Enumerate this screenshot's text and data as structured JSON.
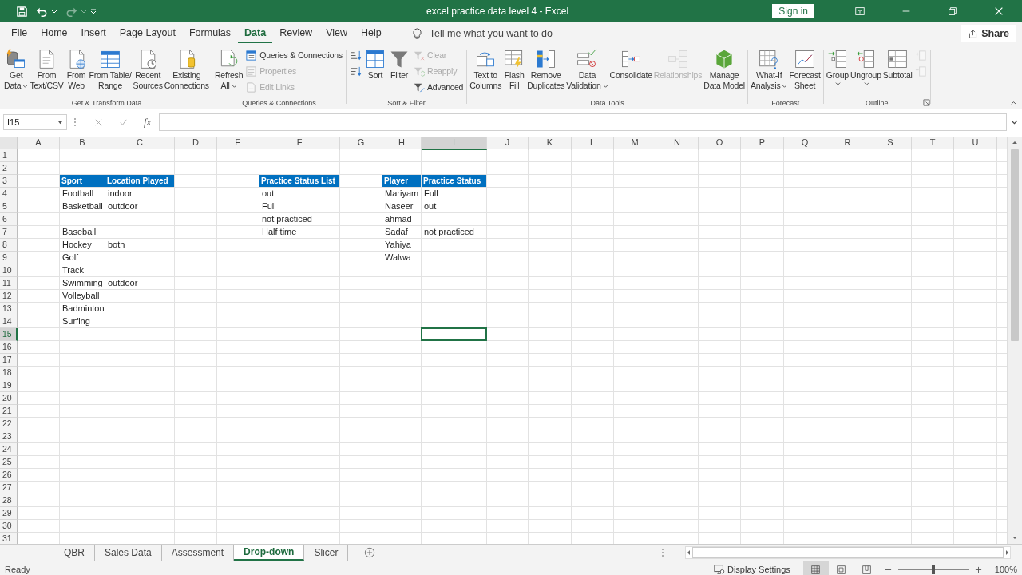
{
  "window": {
    "title": "excel practice data level 4  -  Excel",
    "sign_in": "Sign in"
  },
  "tabs": [
    {
      "label": "File",
      "selected": false
    },
    {
      "label": "Home",
      "selected": false
    },
    {
      "label": "Insert",
      "selected": false
    },
    {
      "label": "Page Layout",
      "selected": false
    },
    {
      "label": "Formulas",
      "selected": false
    },
    {
      "label": "Data",
      "selected": true
    },
    {
      "label": "Review",
      "selected": false
    },
    {
      "label": "View",
      "selected": false
    },
    {
      "label": "Help",
      "selected": false
    }
  ],
  "tell_me": {
    "placeholder": "Tell me what you want to do"
  },
  "share": "Share",
  "ribbon": [
    {
      "label": "Get & Transform Data",
      "launcher": false,
      "items": [
        {
          "kind": "large",
          "lines": [
            "Get",
            "Data"
          ],
          "dropdown": true,
          "disabled": false
        },
        {
          "kind": "large",
          "lines": [
            "From",
            "Text/CSV"
          ],
          "dropdown": false,
          "disabled": false
        },
        {
          "kind": "large",
          "lines": [
            "From",
            "Web"
          ],
          "dropdown": false,
          "disabled": false
        },
        {
          "kind": "large",
          "lines": [
            "From Table/",
            "Range"
          ],
          "dropdown": false,
          "disabled": false
        },
        {
          "kind": "large",
          "lines": [
            "Recent",
            "Sources"
          ],
          "dropdown": false,
          "disabled": false
        },
        {
          "kind": "large",
          "lines": [
            "Existing",
            "Connections"
          ],
          "dropdown": false,
          "disabled": false
        }
      ]
    },
    {
      "label": "Queries & Connections",
      "launcher": false,
      "items": [
        {
          "kind": "large",
          "lines": [
            "Refresh",
            "All"
          ],
          "dropdown": true,
          "disabled": false
        },
        {
          "kind": "stack",
          "buttons": [
            {
              "label": "Queries & Connections",
              "disabled": false
            },
            {
              "label": "Properties",
              "disabled": true
            },
            {
              "label": "Edit Links",
              "disabled": true
            }
          ]
        }
      ]
    },
    {
      "label": "Sort & Filter",
      "launcher": false,
      "items": [
        {
          "kind": "stack",
          "buttons": [
            {
              "disabled": false
            },
            {
              "disabled": false
            }
          ]
        },
        {
          "kind": "large",
          "lines": [
            "Sort"
          ],
          "dropdown": false,
          "disabled": false
        },
        {
          "kind": "large",
          "lines": [
            "Filter"
          ],
          "dropdown": false,
          "disabled": false
        },
        {
          "kind": "stack",
          "buttons": [
            {
              "label": "Clear",
              "disabled": true
            },
            {
              "label": "Reapply",
              "disabled": true
            },
            {
              "label": "Advanced",
              "disabled": false
            }
          ]
        }
      ]
    },
    {
      "label": "Data Tools",
      "launcher": false,
      "items": [
        {
          "kind": "large",
          "lines": [
            "Text to",
            "Columns"
          ],
          "dropdown": false,
          "disabled": false
        },
        {
          "kind": "large",
          "lines": [
            "Flash",
            "Fill"
          ],
          "dropdown": false,
          "disabled": false
        },
        {
          "kind": "large",
          "lines": [
            "Remove",
            "Duplicates"
          ],
          "dropdown": false,
          "disabled": false
        },
        {
          "kind": "large",
          "lines": [
            "Data",
            "Validation"
          ],
          "dropdown": true,
          "disabled": false
        },
        {
          "kind": "large",
          "lines": [
            "Consolidate"
          ],
          "dropdown": false,
          "disabled": false
        },
        {
          "kind": "large",
          "lines": [
            "Relationships"
          ],
          "dropdown": false,
          "disabled": true
        },
        {
          "kind": "large",
          "lines": [
            "Manage",
            "Data Model"
          ],
          "dropdown": false,
          "disabled": false
        }
      ]
    },
    {
      "label": "Forecast",
      "launcher": false,
      "items": [
        {
          "kind": "large",
          "lines": [
            "What-If",
            "Analysis"
          ],
          "dropdown": true,
          "disabled": false
        },
        {
          "kind": "large",
          "lines": [
            "Forecast",
            "Sheet"
          ],
          "dropdown": false,
          "disabled": false
        }
      ]
    },
    {
      "label": "Outline",
      "launcher": true,
      "items": [
        {
          "kind": "large",
          "lines": [
            "Group"
          ],
          "dropdown": true,
          "disabled": false
        },
        {
          "kind": "large",
          "lines": [
            "Ungroup"
          ],
          "dropdown": true,
          "disabled": false
        },
        {
          "kind": "large",
          "lines": [
            "Subtotal"
          ],
          "dropdown": false,
          "disabled": false
        },
        {
          "kind": "stack",
          "buttons": [
            {
              "disabled": true
            },
            {
              "disabled": true
            }
          ]
        }
      ]
    }
  ],
  "formula_bar": {
    "name_box": "I15",
    "function_label": "fx"
  },
  "columns": [
    {
      "label": "A",
      "selected": false
    },
    {
      "label": "B",
      "selected": false
    },
    {
      "label": "C",
      "selected": false
    },
    {
      "label": "D",
      "selected": false
    },
    {
      "label": "E",
      "selected": false
    },
    {
      "label": "F",
      "selected": false
    },
    {
      "label": "G",
      "selected": false
    },
    {
      "label": "H",
      "selected": false
    },
    {
      "label": "I",
      "selected": true
    },
    {
      "label": "J",
      "selected": false
    },
    {
      "label": "K",
      "selected": false
    },
    {
      "label": "L",
      "selected": false
    },
    {
      "label": "M",
      "selected": false
    },
    {
      "label": "N",
      "selected": false
    },
    {
      "label": "O",
      "selected": false
    },
    {
      "label": "P",
      "selected": false
    },
    {
      "label": "Q",
      "selected": false
    },
    {
      "label": "R",
      "selected": false
    },
    {
      "label": "S",
      "selected": false
    },
    {
      "label": "T",
      "selected": false
    },
    {
      "label": "U",
      "selected": false
    }
  ],
  "rows": [
    {
      "number": "1",
      "selected": false
    },
    {
      "number": "2",
      "selected": false
    },
    {
      "number": "3",
      "selected": false,
      "cells": [
        null,
        {
          "text": "Sport",
          "kind": "header"
        },
        {
          "text": "Location Played",
          "kind": "header"
        },
        null,
        null,
        {
          "text": "Practice Status List",
          "kind": "header"
        },
        null,
        {
          "text": "Player",
          "kind": "header"
        },
        {
          "text": "Practice Status",
          "kind": "header"
        }
      ]
    },
    {
      "number": "4",
      "selected": false,
      "cells": [
        null,
        {
          "text": "Football",
          "kind": "value"
        },
        {
          "text": "indoor",
          "kind": "value"
        },
        null,
        null,
        {
          "text": "out",
          "kind": "value"
        },
        null,
        {
          "text": "Mariyam",
          "kind": "value"
        },
        {
          "text": "Full",
          "kind": "value"
        }
      ]
    },
    {
      "number": "5",
      "selected": false,
      "cells": [
        null,
        {
          "text": "Basketball",
          "kind": "value"
        },
        {
          "text": "outdoor",
          "kind": "value"
        },
        null,
        null,
        {
          "text": "Full",
          "kind": "value"
        },
        null,
        {
          "text": "Naseer",
          "kind": "value"
        },
        {
          "text": "out",
          "kind": "value"
        }
      ]
    },
    {
      "number": "6",
      "selected": false,
      "cells": [
        null,
        null,
        null,
        null,
        null,
        {
          "text": "not practiced",
          "kind": "value"
        },
        null,
        {
          "text": "ahmad",
          "kind": "value"
        }
      ]
    },
    {
      "number": "7",
      "selected": false,
      "cells": [
        null,
        {
          "text": "Baseball",
          "kind": "value"
        },
        null,
        null,
        null,
        {
          "text": "Half time",
          "kind": "value"
        },
        null,
        {
          "text": "Sadaf",
          "kind": "value"
        },
        {
          "text": "not practiced",
          "kind": "value"
        }
      ]
    },
    {
      "number": "8",
      "selected": false,
      "cells": [
        null,
        {
          "text": "Hockey",
          "kind": "value"
        },
        {
          "text": "both",
          "kind": "value"
        },
        null,
        null,
        null,
        null,
        {
          "text": "Yahiya",
          "kind": "value"
        }
      ]
    },
    {
      "number": "9",
      "selected": false,
      "cells": [
        null,
        {
          "text": "Golf",
          "kind": "value"
        },
        null,
        null,
        null,
        null,
        null,
        {
          "text": "Walwa",
          "kind": "value"
        }
      ]
    },
    {
      "number": "10",
      "selected": false,
      "cells": [
        null,
        {
          "text": "Track",
          "kind": "value"
        }
      ]
    },
    {
      "number": "11",
      "selected": false,
      "cells": [
        null,
        {
          "text": "Swimming",
          "kind": "value"
        },
        {
          "text": "outdoor",
          "kind": "value"
        }
      ]
    },
    {
      "number": "12",
      "selected": false,
      "cells": [
        null,
        {
          "text": "Volleyball",
          "kind": "value"
        }
      ]
    },
    {
      "number": "13",
      "selected": false,
      "cells": [
        null,
        {
          "text": "Badminton",
          "kind": "value"
        }
      ]
    },
    {
      "number": "14",
      "selected": false,
      "cells": [
        null,
        {
          "text": "Surfing",
          "kind": "value"
        }
      ]
    },
    {
      "number": "15",
      "selected": true
    },
    {
      "number": "16",
      "selected": false
    },
    {
      "number": "17",
      "selected": false
    },
    {
      "number": "18",
      "selected": false
    },
    {
      "number": "19",
      "selected": false
    },
    {
      "number": "20",
      "selected": false
    },
    {
      "number": "21",
      "selected": false
    },
    {
      "number": "22",
      "selected": false
    },
    {
      "number": "23",
      "selected": false
    },
    {
      "number": "24",
      "selected": false
    },
    {
      "number": "25",
      "selected": false
    },
    {
      "number": "26",
      "selected": false
    },
    {
      "number": "27",
      "selected": false
    },
    {
      "number": "28",
      "selected": false
    },
    {
      "number": "29",
      "selected": false
    },
    {
      "number": "30",
      "selected": false
    },
    {
      "number": "31",
      "selected": false
    }
  ],
  "sheets": [
    {
      "label": "QBR",
      "selected": false
    },
    {
      "label": "Sales Data",
      "selected": false
    },
    {
      "label": "Assessment",
      "selected": false
    },
    {
      "label": "Drop-down",
      "selected": true
    },
    {
      "label": "Slicer",
      "selected": false
    }
  ],
  "status_bar": {
    "status": "Ready",
    "display_settings": "Display Settings",
    "views": [
      {
        "selected": true
      },
      {
        "selected": false
      },
      {
        "selected": false
      }
    ],
    "zoom": {
      "level": 0.5
    },
    "zoom_label": "100%"
  }
}
